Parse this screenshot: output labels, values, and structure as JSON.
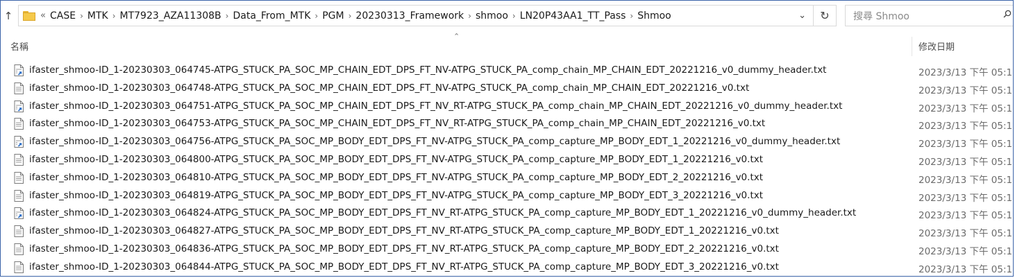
{
  "address_bar": {
    "lead": "«",
    "crumbs": [
      "CASE",
      "MTK",
      "MT7923_AZA11308B",
      "Data_From_MTK",
      "PGM",
      "20230313_Framework",
      "shmoo",
      "LN20P43AA1_TT_Pass",
      "Shmoo"
    ],
    "dropdown_glyph": "⌄",
    "refresh_glyph": "↻",
    "up_glyph": "↑"
  },
  "search": {
    "placeholder": "搜尋 Shmoo"
  },
  "columns": {
    "name": "名稱",
    "date_modified": "修改日期",
    "sort_glyph": "⌃"
  },
  "files": [
    {
      "name": "ifaster_shmoo-ID_1-20230303_064745-ATPG_STUCK_PA_SOC_MP_CHAIN_EDT_DPS_FT_NV-ATPG_STUCK_PA_comp_chain_MP_CHAIN_EDT_20221216_v0_dummy_header.txt",
      "date": "2023/3/13 下午 05:1",
      "icon": "text-file-shortcut-icon"
    },
    {
      "name": "ifaster_shmoo-ID_1-20230303_064748-ATPG_STUCK_PA_SOC_MP_CHAIN_EDT_DPS_FT_NV-ATPG_STUCK_PA_comp_chain_MP_CHAIN_EDT_20221216_v0.txt",
      "date": "2023/3/13 下午 05:1",
      "icon": "text-file-icon"
    },
    {
      "name": "ifaster_shmoo-ID_1-20230303_064751-ATPG_STUCK_PA_SOC_MP_CHAIN_EDT_DPS_FT_NV_RT-ATPG_STUCK_PA_comp_chain_MP_CHAIN_EDT_20221216_v0_dummy_header.txt",
      "date": "2023/3/13 下午 05:1",
      "icon": "text-file-shortcut-icon"
    },
    {
      "name": "ifaster_shmoo-ID_1-20230303_064753-ATPG_STUCK_PA_SOC_MP_CHAIN_EDT_DPS_FT_NV_RT-ATPG_STUCK_PA_comp_chain_MP_CHAIN_EDT_20221216_v0.txt",
      "date": "2023/3/13 下午 05:1",
      "icon": "text-file-icon"
    },
    {
      "name": "ifaster_shmoo-ID_1-20230303_064756-ATPG_STUCK_PA_SOC_MP_BODY_EDT_DPS_FT_NV-ATPG_STUCK_PA_comp_capture_MP_BODY_EDT_1_20221216_v0_dummy_header.txt",
      "date": "2023/3/13 下午 05:1",
      "icon": "text-file-shortcut-icon"
    },
    {
      "name": "ifaster_shmoo-ID_1-20230303_064800-ATPG_STUCK_PA_SOC_MP_BODY_EDT_DPS_FT_NV-ATPG_STUCK_PA_comp_capture_MP_BODY_EDT_1_20221216_v0.txt",
      "date": "2023/3/13 下午 05:1",
      "icon": "text-file-icon"
    },
    {
      "name": "ifaster_shmoo-ID_1-20230303_064810-ATPG_STUCK_PA_SOC_MP_BODY_EDT_DPS_FT_NV-ATPG_STUCK_PA_comp_capture_MP_BODY_EDT_2_20221216_v0.txt",
      "date": "2023/3/13 下午 05:1",
      "icon": "text-file-icon"
    },
    {
      "name": "ifaster_shmoo-ID_1-20230303_064819-ATPG_STUCK_PA_SOC_MP_BODY_EDT_DPS_FT_NV-ATPG_STUCK_PA_comp_capture_MP_BODY_EDT_3_20221216_v0.txt",
      "date": "2023/3/13 下午 05:1",
      "icon": "text-file-icon"
    },
    {
      "name": "ifaster_shmoo-ID_1-20230303_064824-ATPG_STUCK_PA_SOC_MP_BODY_EDT_DPS_FT_NV_RT-ATPG_STUCK_PA_comp_capture_MP_BODY_EDT_1_20221216_v0_dummy_header.txt",
      "date": "2023/3/13 下午 05:1",
      "icon": "text-file-shortcut-icon"
    },
    {
      "name": "ifaster_shmoo-ID_1-20230303_064827-ATPG_STUCK_PA_SOC_MP_BODY_EDT_DPS_FT_NV_RT-ATPG_STUCK_PA_comp_capture_MP_BODY_EDT_1_20221216_v0.txt",
      "date": "2023/3/13 下午 05:1",
      "icon": "text-file-icon"
    },
    {
      "name": "ifaster_shmoo-ID_1-20230303_064836-ATPG_STUCK_PA_SOC_MP_BODY_EDT_DPS_FT_NV_RT-ATPG_STUCK_PA_comp_capture_MP_BODY_EDT_2_20221216_v0.txt",
      "date": "2023/3/13 下午 05:1",
      "icon": "text-file-icon"
    },
    {
      "name": "ifaster_shmoo-ID_1-20230303_064844-ATPG_STUCK_PA_SOC_MP_BODY_EDT_DPS_FT_NV_RT-ATPG_STUCK_PA_comp_capture_MP_BODY_EDT_3_20221216_v0.txt",
      "date": "2023/3/13 下午 05:1",
      "icon": "text-file-icon"
    }
  ]
}
